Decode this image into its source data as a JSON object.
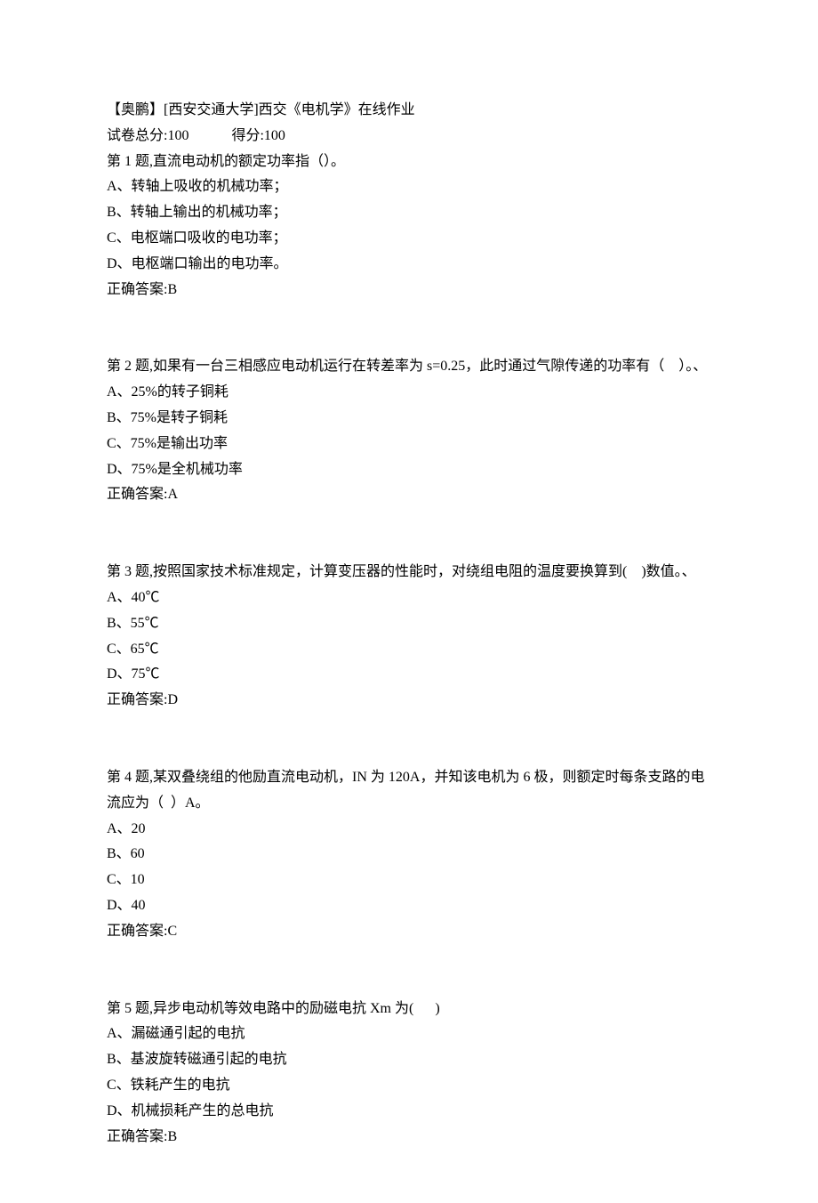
{
  "header": {
    "title": "【奥鹏】[西安交通大学]西交《电机学》在线作业",
    "total_label": "试卷总分:100",
    "score_label": "得分:100"
  },
  "questions": [
    {
      "prompt": "第 1 题,直流电动机的额定功率指（）。",
      "options": [
        "A、转轴上吸收的机械功率；",
        "B、转轴上输出的机械功率；",
        "C、电枢端口吸收的电功率；",
        "D、电枢端口输出的电功率。"
      ],
      "answer": "正确答案:B"
    },
    {
      "prompt": "第 2 题,如果有一台三相感应电动机运行在转差率为 s=0.25，此时通过气隙传递的功率有（    ）。、",
      "options": [
        "A、25%的转子铜耗",
        "B、75%是转子铜耗",
        "C、75%是输出功率",
        "D、75%是全机械功率"
      ],
      "answer": "正确答案:A"
    },
    {
      "prompt": "第 3 题,按照国家技术标准规定，计算变压器的性能时，对绕组电阻的温度要换算到(    )数值。、",
      "options": [
        "A、40℃",
        "B、55℃",
        "C、65℃",
        "D、75℃"
      ],
      "answer": "正确答案:D"
    },
    {
      "prompt": "第 4 题,某双叠绕组的他励直流电动机，IN 为 120A，并知该电机为 6 极，则额定时每条支路的电流应为（  ）A。",
      "options": [
        "A、20",
        "B、60",
        "C、10",
        "D、40"
      ],
      "answer": "正确答案:C"
    },
    {
      "prompt": "第 5 题,异步电动机等效电路中的励磁电抗 Xm 为(      )",
      "options": [
        "A、漏磁通引起的电抗",
        "B、基波旋转磁通引起的电抗",
        "C、铁耗产生的电抗",
        "D、机械损耗产生的总电抗"
      ],
      "answer": "正确答案:B"
    }
  ]
}
